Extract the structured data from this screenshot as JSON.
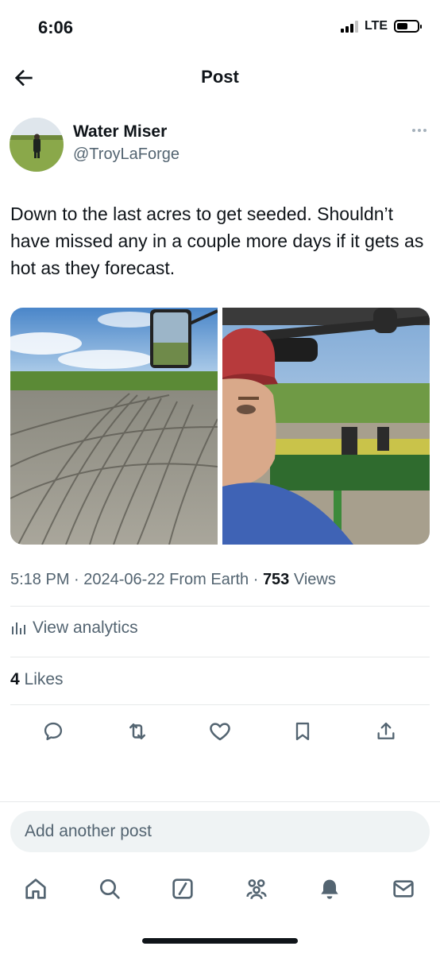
{
  "status_bar": {
    "time": "6:06",
    "network": "LTE",
    "battery_level": 0.55
  },
  "header": {
    "title": "Post",
    "back_icon": "arrow-left-icon"
  },
  "author": {
    "display_name": "Water Miser",
    "handle": "@TroyLaForge",
    "more_icon": "more-horizontal-icon"
  },
  "post": {
    "text": "Down to the last acres to get seeded. Shouldn’t have missed any in a couple more days if it gets as hot as they forecast.",
    "media": [
      {
        "description_icon": "field-photo",
        "alt": ""
      },
      {
        "description_icon": "selfie-photo",
        "alt": ""
      }
    ]
  },
  "meta": {
    "time": "5:18 PM",
    "separator1": " · ",
    "date": "2024-06-22",
    "source": " From Earth",
    "separator2": " · ",
    "views_count": "753",
    "views_label": " Views"
  },
  "analytics": {
    "label": "View analytics",
    "icon": "bar-chart-icon"
  },
  "likes": {
    "count": "4",
    "label": " Likes"
  },
  "actions": [
    {
      "name": "reply",
      "icon": "reply-icon"
    },
    {
      "name": "repost",
      "icon": "repost-icon"
    },
    {
      "name": "like",
      "icon": "heart-icon"
    },
    {
      "name": "bookmark",
      "icon": "bookmark-icon"
    },
    {
      "name": "share",
      "icon": "share-icon"
    }
  ],
  "compose": {
    "placeholder": "Add another post"
  },
  "tabbar": [
    {
      "name": "home",
      "icon": "home-icon"
    },
    {
      "name": "search",
      "icon": "search-icon"
    },
    {
      "name": "grok",
      "icon": "grok-icon"
    },
    {
      "name": "communities",
      "icon": "communities-icon"
    },
    {
      "name": "notifications",
      "icon": "bell-icon"
    },
    {
      "name": "messages",
      "icon": "mail-icon"
    }
  ],
  "colors": {
    "text_primary": "#0f1419",
    "text_secondary": "#536471",
    "divider": "#e7e9ea",
    "compose_bg": "#eff3f4"
  }
}
